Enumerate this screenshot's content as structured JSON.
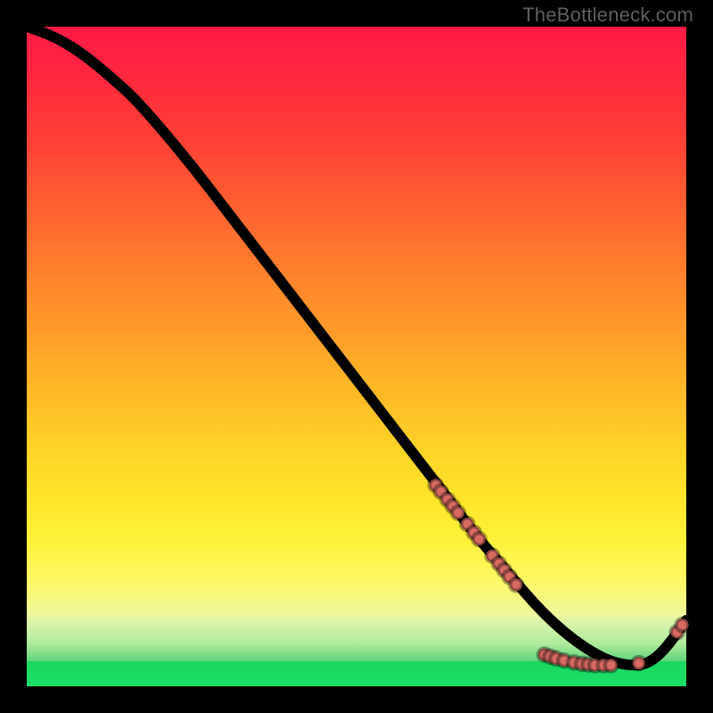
{
  "watermark": "TheBottleneck.com",
  "colors": {
    "marker": "#d86a62",
    "curve": "#000000",
    "green_band": "#1ad65e"
  },
  "chart_data": {
    "type": "line",
    "title": "",
    "xlabel": "",
    "ylabel": "",
    "xlim": [
      0,
      100
    ],
    "ylim": [
      0,
      100
    ],
    "notes": "Axes are unlabeled; values are normalized 0–100 from pixel positions. y=100 is top, y=0 is bottom.",
    "series": [
      {
        "name": "curve",
        "kind": "line",
        "x": [
          0,
          3,
          6,
          9,
          12,
          16,
          20,
          25,
          30,
          35,
          40,
          45,
          50,
          55,
          60,
          65,
          68,
          71,
          74,
          77,
          80,
          83,
          86,
          89,
          92,
          94,
          96,
          98,
          100
        ],
        "y": [
          100,
          99,
          97.5,
          95.5,
          93,
          89.5,
          85,
          79,
          72.5,
          66,
          59.5,
          53,
          46.5,
          40,
          33.5,
          27,
          23,
          19.5,
          16,
          12.5,
          9.5,
          7,
          5,
          3.6,
          3.1,
          3.4,
          4.8,
          7.2,
          10
        ]
      },
      {
        "name": "markers",
        "kind": "scatter",
        "points": [
          {
            "x": 62.0,
            "y": 30.5
          },
          {
            "x": 62.8,
            "y": 29.5
          },
          {
            "x": 63.8,
            "y": 28.3
          },
          {
            "x": 64.6,
            "y": 27.3
          },
          {
            "x": 65.4,
            "y": 26.3
          },
          {
            "x": 66.8,
            "y": 24.6
          },
          {
            "x": 67.8,
            "y": 23.3
          },
          {
            "x": 68.6,
            "y": 22.3
          },
          {
            "x": 70.6,
            "y": 19.8
          },
          {
            "x": 71.6,
            "y": 18.6
          },
          {
            "x": 72.4,
            "y": 17.6
          },
          {
            "x": 73.2,
            "y": 16.6
          },
          {
            "x": 74.2,
            "y": 15.4
          },
          {
            "x": 78.5,
            "y": 4.8
          },
          {
            "x": 79.4,
            "y": 4.5
          },
          {
            "x": 80.3,
            "y": 4.2
          },
          {
            "x": 81.5,
            "y": 3.9
          },
          {
            "x": 83.0,
            "y": 3.6
          },
          {
            "x": 84.2,
            "y": 3.4
          },
          {
            "x": 85.2,
            "y": 3.3
          },
          {
            "x": 86.2,
            "y": 3.2
          },
          {
            "x": 87.5,
            "y": 3.2
          },
          {
            "x": 88.6,
            "y": 3.2
          },
          {
            "x": 92.8,
            "y": 3.5
          },
          {
            "x": 98.6,
            "y": 8.2
          },
          {
            "x": 99.4,
            "y": 9.3
          }
        ]
      }
    ]
  }
}
